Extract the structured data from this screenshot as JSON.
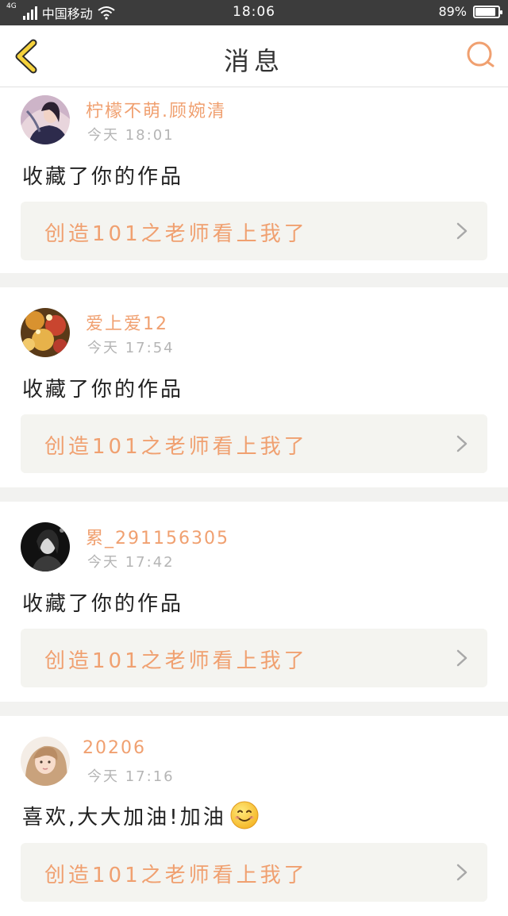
{
  "status_bar": {
    "network": "4G",
    "carrier": "中国移动",
    "time": "18:06",
    "battery_text": "89%",
    "battery_level": 0.89
  },
  "nav": {
    "title": "消息",
    "back_icon": "chevron-left-icon",
    "search_icon": "search-icon",
    "accent_color": "#f0a070"
  },
  "notifications": [
    {
      "username": "柠檬不萌.顾婉清",
      "time": "今天 18:01",
      "message": "收藏了你的作品",
      "work_title": "创造101之老师看上我了"
    },
    {
      "username": "爱上爱12",
      "time": "今天 17:54",
      "message": "收藏了你的作品",
      "work_title": "创造101之老师看上我了"
    },
    {
      "username": "累_291156305",
      "time": "今天 17:42",
      "message": "收藏了你的作品",
      "work_title": "创造101之老师看上我了"
    },
    {
      "username": "20206",
      "time": "今天 17:16",
      "message": "喜欢,大大加油!加油",
      "work_title": "创造101之老师看上我了"
    }
  ]
}
